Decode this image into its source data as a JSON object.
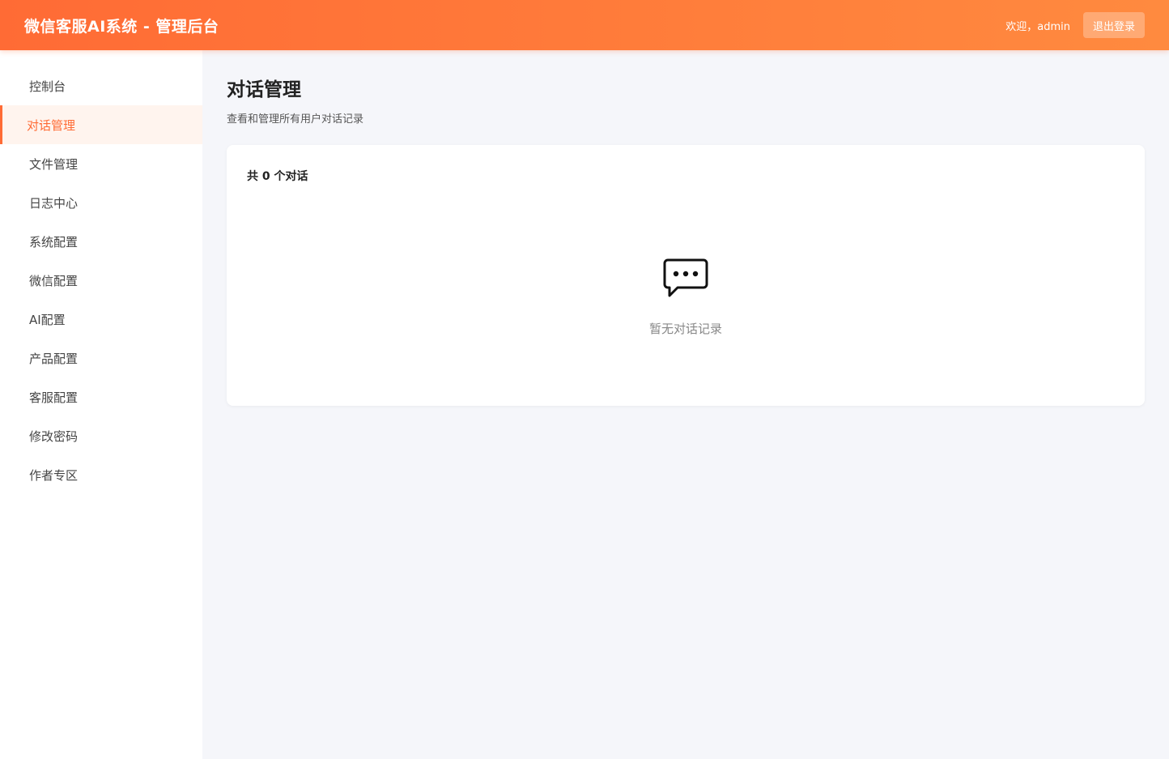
{
  "header": {
    "title": "微信客服AI系统 - 管理后台",
    "welcome": "欢迎，admin",
    "logout_label": "退出登录"
  },
  "sidebar": {
    "items": [
      {
        "label": "控制台"
      },
      {
        "label": "对话管理",
        "active": true
      },
      {
        "label": "文件管理"
      },
      {
        "label": "日志中心"
      },
      {
        "label": "系统配置"
      },
      {
        "label": "微信配置"
      },
      {
        "label": "AI配置"
      },
      {
        "label": "产品配置"
      },
      {
        "label": "客服配置"
      },
      {
        "label": "修改密码"
      },
      {
        "label": "作者专区"
      }
    ]
  },
  "main": {
    "title": "对话管理",
    "subtitle": "查看和管理所有用户对话记录",
    "count_label": "共 0 个对话",
    "empty_icon": "chat-bubble-icon",
    "empty_text": "暂无对话记录"
  },
  "colors": {
    "accent": "#ff6b35",
    "accent_light": "#fff4ee"
  }
}
